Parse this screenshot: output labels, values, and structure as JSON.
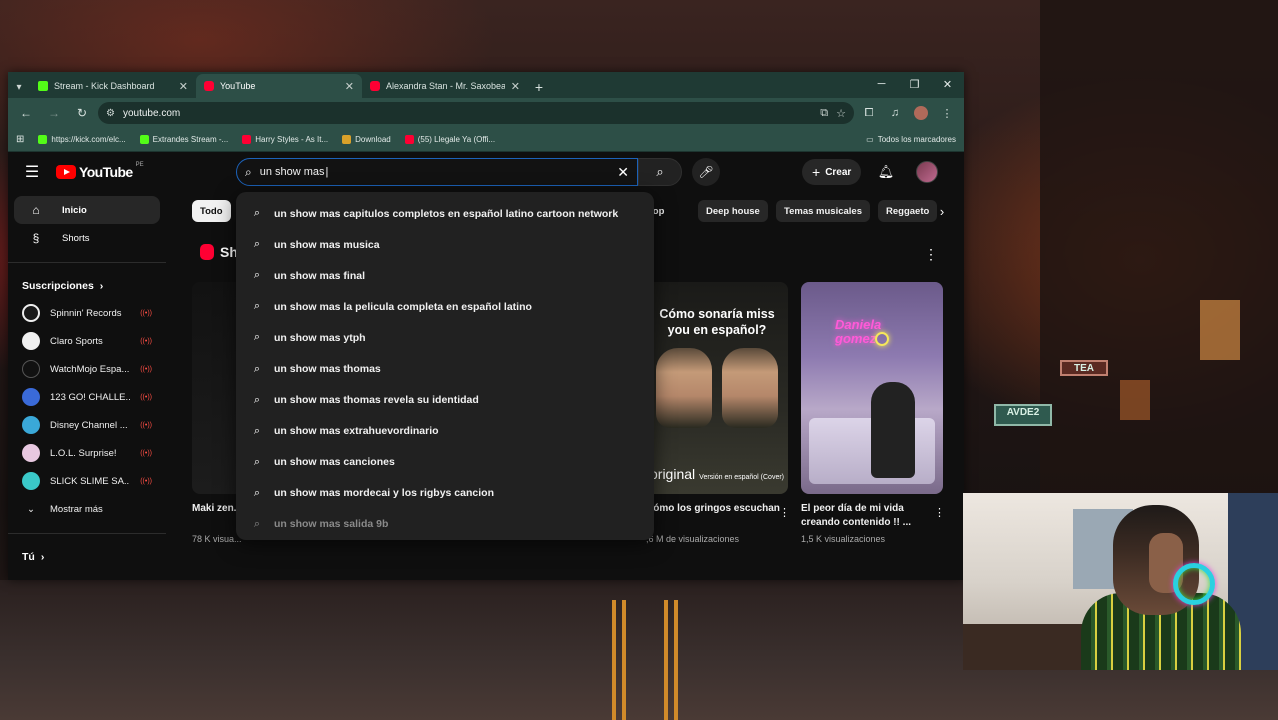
{
  "browser": {
    "tabs": [
      {
        "title": "Stream - Kick Dashboard",
        "favicon": "kick-icon",
        "active": false
      },
      {
        "title": "YouTube",
        "favicon": "youtube-icon",
        "active": true
      },
      {
        "title": "Alexandra Stan - Mr. Saxobeat",
        "favicon": "youtube-icon",
        "active": false
      }
    ],
    "address": "youtube.com",
    "bookmarks": [
      {
        "label": "https://kick.com/elc...",
        "favicon": "kick-icon"
      },
      {
        "label": "Extrandes Stream -...",
        "favicon": "kick-icon"
      },
      {
        "label": "Harry Styles - As It...",
        "favicon": "youtube-icon"
      },
      {
        "label": "Download",
        "favicon": "download-icon"
      },
      {
        "label": "(55) Llegale Ya (Offi...",
        "favicon": "youtube-icon"
      }
    ],
    "all_bookmarks": "Todos los marcadores"
  },
  "youtube": {
    "logo_text": "YouTube",
    "country_code": "PE",
    "search": {
      "query": "un show mas"
    },
    "create_label": "Crear",
    "sidebar": {
      "items": [
        {
          "label": "Inicio",
          "icon": "home-icon",
          "active": true
        },
        {
          "label": "Shorts",
          "icon": "shorts-icon",
          "active": false
        }
      ],
      "subscriptions_title": "Suscripciones",
      "subscriptions": [
        {
          "name": "Spinnin' Records",
          "color": "#1a1a1a"
        },
        {
          "name": "Claro Sports",
          "color": "#f1f1f1"
        },
        {
          "name": "WatchMojo Espa...",
          "color": "#111111"
        },
        {
          "name": "123 GO! CHALLE...",
          "color": "#3a6ad8"
        },
        {
          "name": "Disney Channel ...",
          "color": "#3aa8d8"
        },
        {
          "name": "L.O.L. Surprise!",
          "color": "#e8c8e0"
        },
        {
          "name": "SLICK SLIME SA...",
          "color": "#3ac8c8"
        }
      ],
      "show_more": "Mostrar más",
      "you": "Tú"
    },
    "chips": [
      "Todo",
      "thpop",
      "Deep house",
      "Temas musicales",
      "Reggaeto"
    ],
    "shorts_label": "Sh",
    "shorts": [
      {
        "title": "Maki zen... ver a yut...",
        "views": "78 K visua..."
      },
      {
        "title": "Cómo los gringos escuchan",
        "views": ",6 M de visualizaciones",
        "thumb_title": "Cómo sonaría miss you en español?",
        "thumb_left": "original",
        "thumb_right": "Versión en español (Cover)"
      },
      {
        "title": "El peor día de mi vida creando contenido !! ...",
        "views": "1,5 K visualizaciones"
      }
    ],
    "suggestions": [
      "un show mas capitulos completos en español latino cartoon network",
      "un show mas musica",
      "un show mas final",
      "un show mas la pelicula completa en español latino",
      "un show mas ytph",
      "un show mas thomas",
      "un show mas thomas revela su identidad",
      "un show mas extrahuevordinario",
      "un show mas canciones",
      "un show mas mordecai y los rigbys cancion",
      "un show mas salida 9b"
    ]
  },
  "background": {
    "signs": [
      "AVDE2",
      "TEA"
    ]
  }
}
